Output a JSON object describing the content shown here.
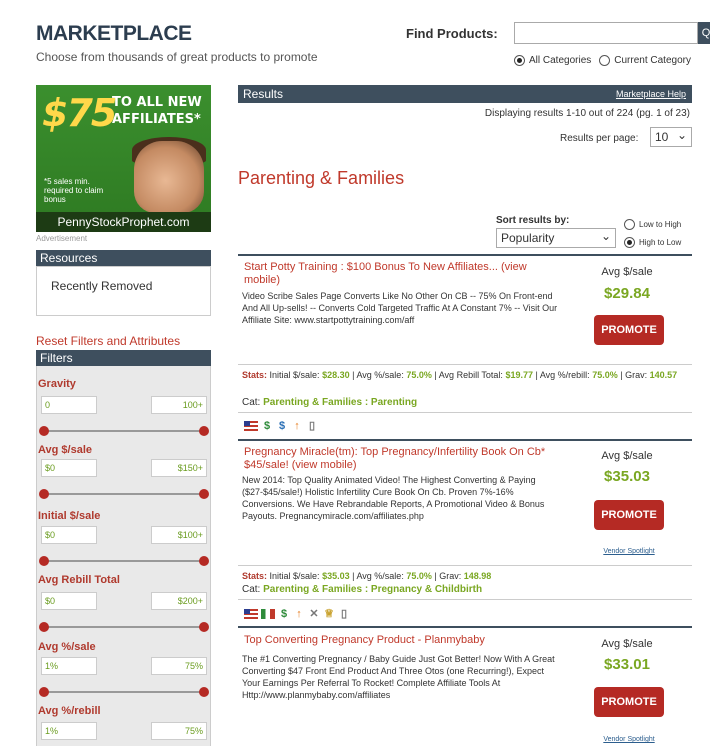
{
  "header": {
    "title": "MARKETPLACE",
    "subtitle": "Choose from thousands of great products to promote",
    "find_label": "Find Products:",
    "search_placeholder": "",
    "search_button": "Q",
    "scope_all": "All Categories",
    "scope_current": "Current Category"
  },
  "ad": {
    "amount": "$75",
    "line1": "TO ALL NEW",
    "line2": "AFFILIATES*",
    "note": "*5 sales min. required to claim bonus",
    "site": "PennyStockProphet.com",
    "caption": "Advertisement"
  },
  "sidebar": {
    "resources_title": "Resources",
    "resources_items": [
      "Recently Removed"
    ],
    "reset_link": "Reset Filters and Attributes",
    "filters_title": "Filters",
    "filters": [
      {
        "label": "Gravity",
        "min": "0",
        "max": "100+"
      },
      {
        "label": "Avg $/sale",
        "min": "$0",
        "max": "$150+"
      },
      {
        "label": "Initial $/sale",
        "min": "$0",
        "max": "$100+"
      },
      {
        "label": "Avg Rebill Total",
        "min": "$0",
        "max": "$200+"
      },
      {
        "label": "Avg %/sale",
        "min": "1%",
        "max": "75%"
      },
      {
        "label": "Avg %/rebill",
        "min": "1%",
        "max": "75%"
      }
    ]
  },
  "results": {
    "bar_title": "Results",
    "help_link": "Marketplace Help",
    "displaying": "Displaying results 1-10 out of 224 (pg. 1 of 23)",
    "per_page_label": "Results per page:",
    "per_page_value": "10",
    "category_title": "Parenting & Families",
    "sort_label": "Sort results by:",
    "sort_value": "Popularity",
    "sort_low_high": "Low to High",
    "sort_high_low": "High to Low"
  },
  "products": [
    {
      "title": "Start Potty Training : $100 Bonus To New Affiliates... (view mobile)",
      "desc": "Video Scribe Sales Page Converts Like No Other On CB -- 75% On Front-end And All Up-sells! -- Converts Cold Targeted Traffic At A Constant 7% -- Visit Our Affiliate Site: www.startpottytraining.com/aff",
      "avg_label": "Avg $/sale",
      "avg_value": "$29.84",
      "promote": "PROMOTE",
      "stats_initial": "$28.30",
      "stats_avg_pct": "75.0%",
      "stats_rebill_total": "$19.77",
      "stats_rebill_pct": "75.0%",
      "stats_grav": "140.57",
      "category": "Parenting & Families : Parenting"
    },
    {
      "title": "Pregnancy Miracle(tm): Top Pregnancy/Infertility Book On Cb* $45/sale! (view mobile)",
      "desc": "New 2014: Top Quality Animated Video! The Highest Converting & Paying ($27-$45/sale!) Holistic Infertility Cure Book On Cb. Proven 7%-16% Conversions. We Have Rebrandable Reports, A Promotional Video & Bonus Payouts. Pregnancymiracle.com/affiliates.php",
      "avg_label": "Avg $/sale",
      "avg_value": "$35.03",
      "promote": "PROMOTE",
      "spotlight": "Vendor Spotlight",
      "stats_initial": "$35.03",
      "stats_avg_pct": "75.0%",
      "stats_grav": "148.98",
      "category": "Parenting & Families : Pregnancy & Childbirth"
    },
    {
      "title": "Top Converting Pregnancy Product - Planmybaby",
      "desc": "The #1 Converting Pregnancy / Baby Guide Just Got Better! Now With A Great Converting $47 Front End Product And Three Otos (one Recurring!), Expect Your Earnings Per Referral To Rocket! Complete Affiliate Tools At Http://www.planmybaby.com/affiliates",
      "avg_label": "Avg $/sale",
      "avg_value": "$33.01",
      "promote": "PROMOTE",
      "spotlight": "Vendor Spotlight"
    }
  ],
  "stats_labels": {
    "stats": "Stats:",
    "initial": "Initial $/sale:",
    "avg_pct": "Avg %/sale:",
    "rebill_total": "Avg Rebill Total:",
    "rebill_pct": "Avg %/rebill:",
    "grav": "Grav:",
    "cat": "Cat:"
  },
  "colors": {
    "header_bar": "#3e4f5e",
    "accent_red": "#b52a24",
    "value_green": "#7aa722"
  }
}
